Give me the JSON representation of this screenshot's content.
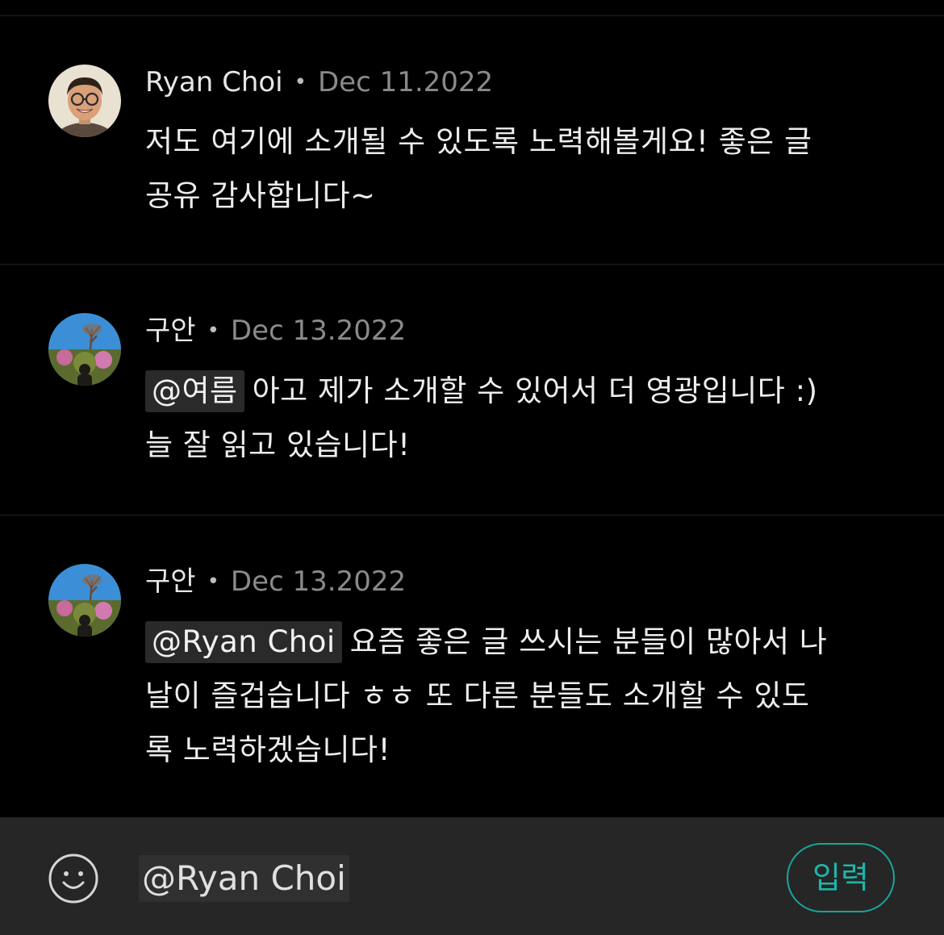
{
  "comments": [
    {
      "author": "Ryan Choi",
      "separator": "•",
      "date": "Dec 11.2022",
      "mention": "",
      "lines": [
        "저도 여기에 소개될 수 있도록 노력해볼게요! 좋은 글",
        "공유 감사합니다~"
      ],
      "avatar": "avatar-man-glasses"
    },
    {
      "author": "구안",
      "separator": "•",
      "date": "Dec 13.2022",
      "mention": "@여름",
      "lines": [
        "아고 제가 소개할 수 있어서 더 영광입니다 :)",
        "늘 잘 읽고 있습니다!"
      ],
      "avatar": "avatar-landscape-person"
    },
    {
      "author": "구안",
      "separator": "•",
      "date": "Dec 13.2022",
      "mention": "@Ryan Choi",
      "lines": [
        "요즘 좋은 글 쓰시는 분들이 많아서 나",
        "날이 즐겁습니다 ㅎㅎ 또 다른 분들도 소개할 수 있도",
        "록 노력하겠습니다!"
      ],
      "avatar": "avatar-landscape-person"
    }
  ],
  "composer": {
    "emoji_icon": "smiley-icon",
    "input_value": "@Ryan Choi",
    "submit_label": "입력"
  },
  "colors": {
    "background": "#000000",
    "bottom_bar": "#262626",
    "accent": "#1fb5a8",
    "date": "#8a8a8a"
  }
}
